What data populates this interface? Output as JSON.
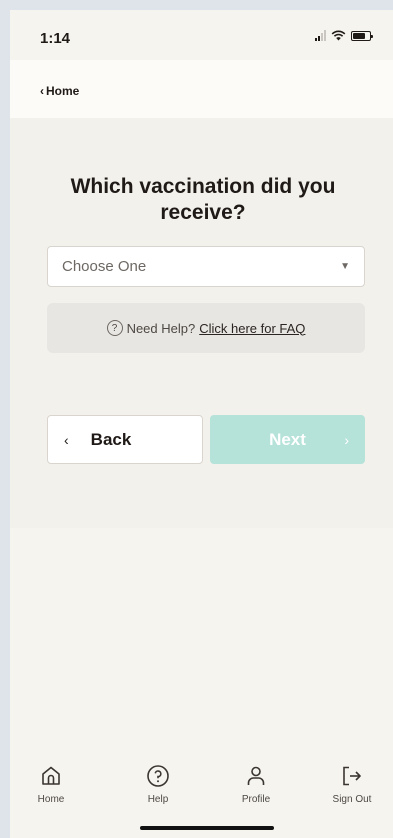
{
  "status_bar": {
    "time": "1:14"
  },
  "nav": {
    "back_label": "Home"
  },
  "main": {
    "title": "Which vaccination did you receive?",
    "select": {
      "placeholder": "Choose One"
    },
    "help": {
      "prefix": "Need Help?",
      "link": "Click here for FAQ"
    },
    "back_button": "Back",
    "next_button": "Next"
  },
  "tabbar": {
    "items": [
      {
        "label": "Home",
        "icon": "home-icon"
      },
      {
        "label": "Help",
        "icon": "help-icon"
      },
      {
        "label": "Profile",
        "icon": "profile-icon"
      },
      {
        "label": "Sign Out",
        "icon": "sign-out-icon"
      }
    ]
  },
  "colors": {
    "next_disabled": "#b5e2d9",
    "background": "#f3f1ec"
  }
}
